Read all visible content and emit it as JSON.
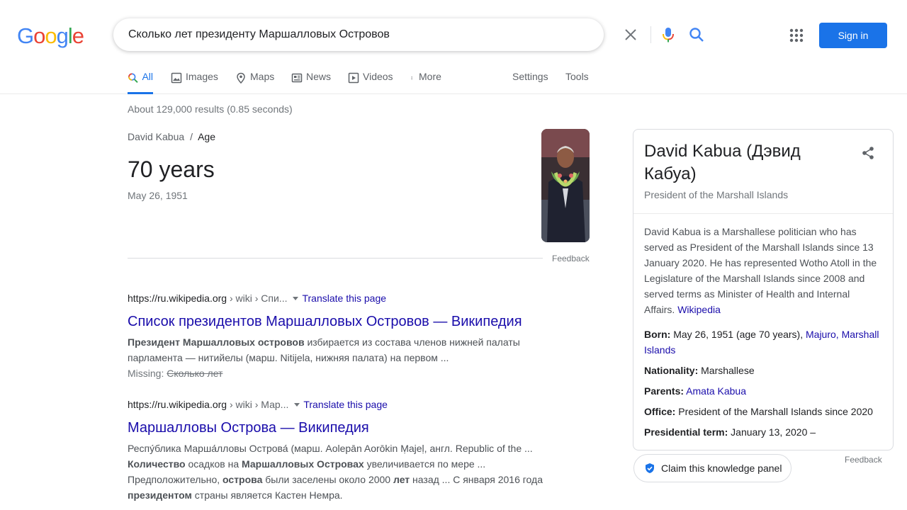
{
  "logo": {
    "text": "Google"
  },
  "search": {
    "query": "Сколько лет президенту Маршалловых Островов"
  },
  "header": {
    "signin_label": "Sign in"
  },
  "tabs": [
    {
      "label": "All",
      "icon": "search-icon",
      "active": true
    },
    {
      "label": "Images",
      "icon": "image-icon"
    },
    {
      "label": "Maps",
      "icon": "map-pin-icon"
    },
    {
      "label": "News",
      "icon": "news-icon"
    },
    {
      "label": "Videos",
      "icon": "play-icon"
    },
    {
      "label": "More",
      "icon": "more-vert-icon"
    },
    {
      "label": "Settings"
    },
    {
      "label": "Tools"
    }
  ],
  "result_stats": "About 129,000 results (0.85 seconds)",
  "answer": {
    "crumb_entity": "David Kabua",
    "crumb_sep": "/",
    "crumb_attr": "Age",
    "value": "70 years",
    "date": "May 26, 1951",
    "feedback": "Feedback"
  },
  "results": [
    {
      "site": "https://ru.wikipedia.org",
      "path": " › wiki › Спи...",
      "translate": "Translate this page",
      "title": "Список президентов Маршалловых Островов — Википедия",
      "snippet_bold_1": "Президент Маршалловых островов",
      "snippet_rest_1": " избирается из состава членов нижней палаты парламента — нитийелы (марш. Nitijela, нижняя палата) на первом ...",
      "missing_label": "Missing: ",
      "missing_terms": "Сколько лет"
    },
    {
      "site": "https://ru.wikipedia.org",
      "path": " › wiki › Мар...",
      "translate": "Translate this page",
      "title": "Маршалловы Острова — Википедия",
      "s1": "Респу́блика Марша́лловы Острова́ (марш. Aolepān Aorōkin Ṃajeḷ, англ. Republic of the ...",
      "s2_bold_a": "Количество",
      "s2_text_a": " осадков на ",
      "s2_bold_b": "Маршалловых Островах",
      "s2_text_b": " увеличивается по мере ...",
      "s3_text_a": "Предположительно, ",
      "s3_bold_a": "острова",
      "s3_text_b": " были заселены около 2000 ",
      "s3_bold_b": "лет",
      "s3_text_c": " назад ... С января 2016 года",
      "s4_bold_a": "президентом",
      "s4_text_a": " страны является Кастен Немра."
    }
  ],
  "knowledge_panel": {
    "title": "David Kabua (Дэвид Кабуа)",
    "subtitle": "President of the Marshall Islands",
    "description": "David Kabua is a Marshallese politician who has served as President of the Marshall Islands since 13 January 2020. He has represented Wotho Atoll in the Legislature of the Marshall Islands since 2008 and served terms as Minister of Health and Internal Affairs.",
    "source_link": "Wikipedia",
    "born_label": "Born:",
    "born_value": "May 26, 1951 (age 70 years),",
    "born_link": "Majuro, Marshall Islands",
    "nationality_label": "Nationality:",
    "nationality_value": "Marshallese",
    "parents_label": "Parents:",
    "parents_link": "Amata Kabua",
    "office_label": "Office:",
    "office_value": "President of the Marshall Islands since 2020",
    "term_label": "Presidential term:",
    "term_value": "January 13, 2020 –",
    "feedback": "Feedback",
    "claim_label": "Claim this knowledge panel"
  },
  "colors": {
    "accent": "#1a73e8",
    "link": "#1a0dab",
    "muted": "#70757a"
  }
}
